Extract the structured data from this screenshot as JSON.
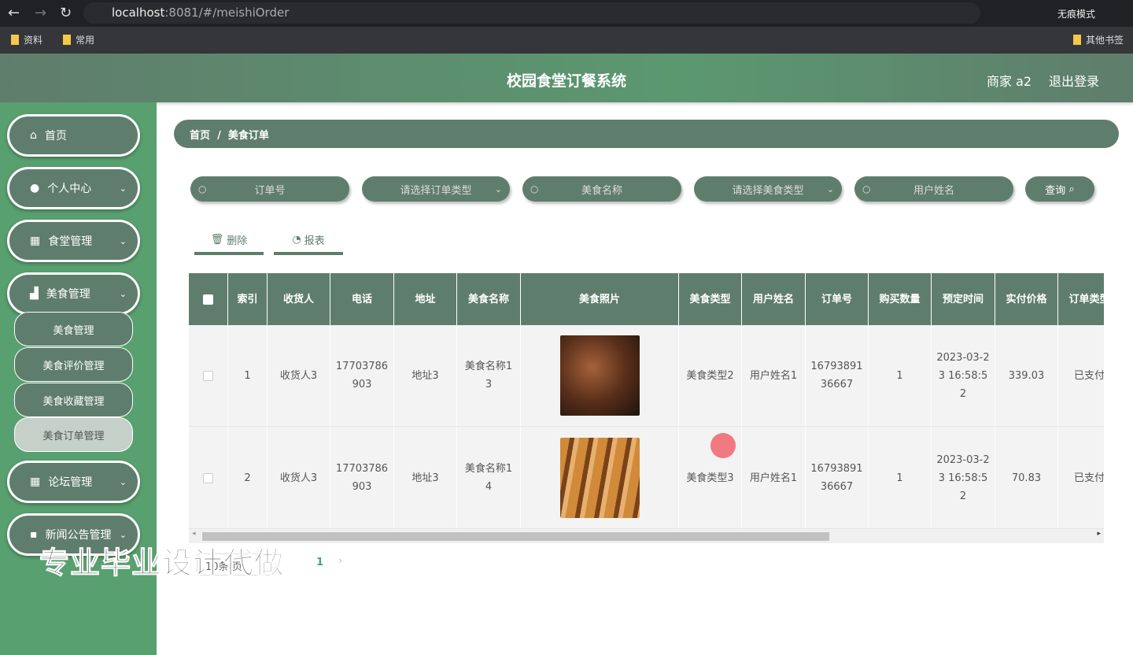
{
  "browser": {
    "url_host": "localhost",
    "url_rest": ":8081/#/meishiOrder",
    "incognito": "无痕模式",
    "bookmarks": [
      "资料",
      "常用"
    ],
    "other_bookmarks": "其他书签"
  },
  "header": {
    "title": "校园食堂订餐系统",
    "user": "商家 a2",
    "logout": "退出登录"
  },
  "sidebar": {
    "items": [
      "首页",
      "个人中心",
      "食堂管理",
      "美食管理",
      "论坛管理",
      "新闻公告管理"
    ],
    "sub": [
      "美食管理",
      "美食评价管理",
      "美食收藏管理",
      "美食订单管理"
    ]
  },
  "breadcrumb": {
    "home": "首页",
    "sep": "/",
    "current": "美食订单"
  },
  "search": {
    "order_no": "订单号",
    "order_type": "请选择订单类型",
    "food_name": "美食名称",
    "food_type": "请选择美食类型",
    "user_name": "用户姓名",
    "query": "查询"
  },
  "actions": {
    "delete": "删除",
    "report": "报表"
  },
  "table": {
    "headers": [
      "索引",
      "收货人",
      "电话",
      "地址",
      "美食名称",
      "美食照片",
      "美食类型",
      "用户姓名",
      "订单号",
      "购买数量",
      "预定时间",
      "实付价格",
      "订单类型"
    ],
    "rows": [
      [
        "1",
        "收货人3",
        "17703786903",
        "地址3",
        "美食名称13",
        "",
        "美食类型2",
        "用户姓名1",
        "1679389136667",
        "1",
        "2023-03-23 16:58:52",
        "339.03",
        "已支付"
      ],
      [
        "2",
        "收货人3",
        "17703786903",
        "地址3",
        "美食名称14",
        "",
        "美食类型3",
        "用户姓名1",
        "1679389136667",
        "1",
        "2023-03-23 16:58:52",
        "70.83",
        "已支付"
      ]
    ]
  },
  "pagination": {
    "page_size": "10条/页",
    "current": "1"
  },
  "watermark": "专业毕业设计代做"
}
